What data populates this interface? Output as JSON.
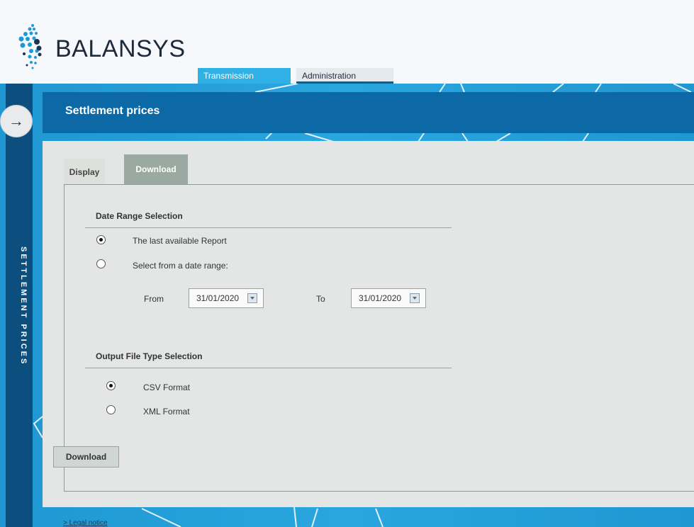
{
  "header": {
    "brand": "BALANSYS",
    "nav": [
      {
        "label": "Transmission"
      },
      {
        "label": "Administration"
      }
    ]
  },
  "sidebar": {
    "label": "SETTLEMENT PRICES",
    "toggle_icon": "→"
  },
  "page": {
    "title": "Settlement prices"
  },
  "tabs": [
    {
      "label": "Display"
    },
    {
      "label": "Download"
    }
  ],
  "date_range": {
    "title": "Date Range Selection",
    "option_last": "The last available Report",
    "option_range": "Select from a date range:",
    "from_label": "From",
    "from_value": "31/01/2020",
    "to_label": "To",
    "to_value": "31/01/2020"
  },
  "output": {
    "title": "Output File Type Selection",
    "option_csv": "CSV Format",
    "option_xml": "XML Format"
  },
  "actions": {
    "download_label": "Download"
  },
  "footer": {
    "legal": "> Legal notice"
  },
  "colors": {
    "brand_dark": "#0c4f7f",
    "title_bar": "#0c69a6",
    "accent": "#2fb1e6",
    "panel": "#e3e6e4",
    "active_tab": "#9aa9a2"
  }
}
